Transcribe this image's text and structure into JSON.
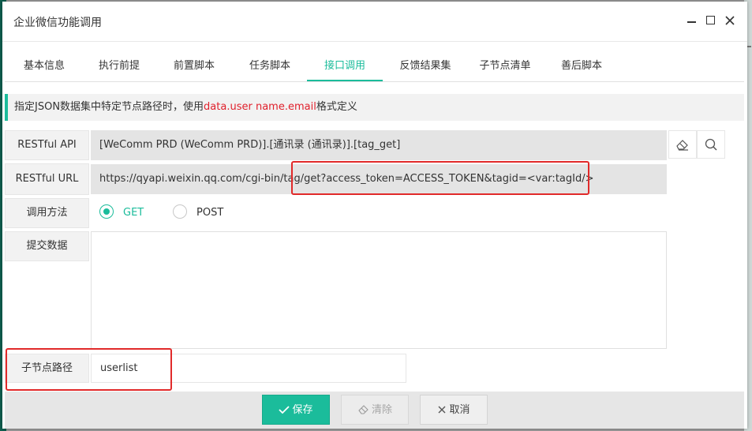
{
  "window": {
    "title": "企业微信功能调用",
    "controls": [
      "minimize-icon",
      "maximize-icon",
      "close-icon"
    ]
  },
  "tabs": [
    {
      "label": "基本信息",
      "active": false
    },
    {
      "label": "执行前提",
      "active": false
    },
    {
      "label": "前置脚本",
      "active": false
    },
    {
      "label": "任务脚本",
      "active": false
    },
    {
      "label": "接口调用",
      "active": true
    },
    {
      "label": "反馈结果集",
      "active": false
    },
    {
      "label": "子节点清单",
      "active": false
    },
    {
      "label": "善后脚本",
      "active": false
    }
  ],
  "notice": {
    "prefix": "指定JSON数据集中特定节点路径时，使用",
    "highlight": "data.user name.email",
    "suffix": "格式定义"
  },
  "form": {
    "restful_api": {
      "label": "RESTful API",
      "value": "[WeComm PRD (WeComm PRD)].[通讯录 (通讯录)].[tag_get]",
      "icons": [
        "eraser-icon",
        "search-icon"
      ]
    },
    "restful_url": {
      "label": "RESTful URL",
      "value": "https://qyapi.weixin.qq.com/cgi-bin/tag/get?access_token=ACCESS_TOKEN&tagid=<var:tagId/>"
    },
    "method": {
      "label": "调用方法",
      "options": [
        {
          "label": "GET",
          "selected": true
        },
        {
          "label": "POST",
          "selected": false
        }
      ]
    },
    "payload": {
      "label": "提交数据",
      "value": ""
    },
    "child_path": {
      "label": "子节点路径",
      "value": "userlist"
    }
  },
  "footer": {
    "save_label": "保存",
    "clear_label": "清除",
    "cancel_label": "取消"
  },
  "colors": {
    "accent": "#1bbc9b",
    "highlight_red": "#e12a2a",
    "readonly_bg": "#e4e4e4"
  }
}
